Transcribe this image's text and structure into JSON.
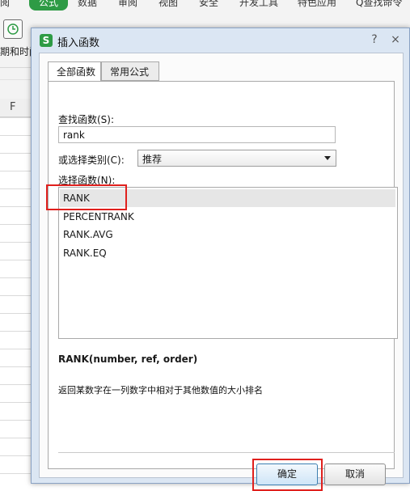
{
  "background_app": {
    "menu": [
      "阅",
      "数据",
      "审阅",
      "视图",
      "安全",
      "开发工具",
      "特色应用",
      "Q查找命令"
    ],
    "active_menu": "公式",
    "toolbar_label": "期和时间",
    "column_header": "F",
    "accent_color": "#2e9b45"
  },
  "dialog": {
    "app_icon_text": "S",
    "title": "插入函数",
    "title_buttons": [
      "?",
      "×"
    ],
    "tabs": [
      {
        "label": "全部函数",
        "active": true
      },
      {
        "label": "常用公式",
        "active": false
      }
    ],
    "search_label": "查找函数(S):",
    "search_value": "rank",
    "category_label": "或选择类别(C):",
    "category_value": "推荐",
    "function_list_label": "选择函数(N):",
    "functions": [
      "RANK",
      "PERCENTRANK",
      "RANK.AVG",
      "RANK.EQ"
    ],
    "selected_function": "RANK",
    "function_signature": "RANK(number, ref, order)",
    "function_description": "返回某数字在一列数字中相对于其他数值的大小排名",
    "ok_button": "确定",
    "cancel_button": "取消",
    "highlight_color": "#e0201d"
  }
}
